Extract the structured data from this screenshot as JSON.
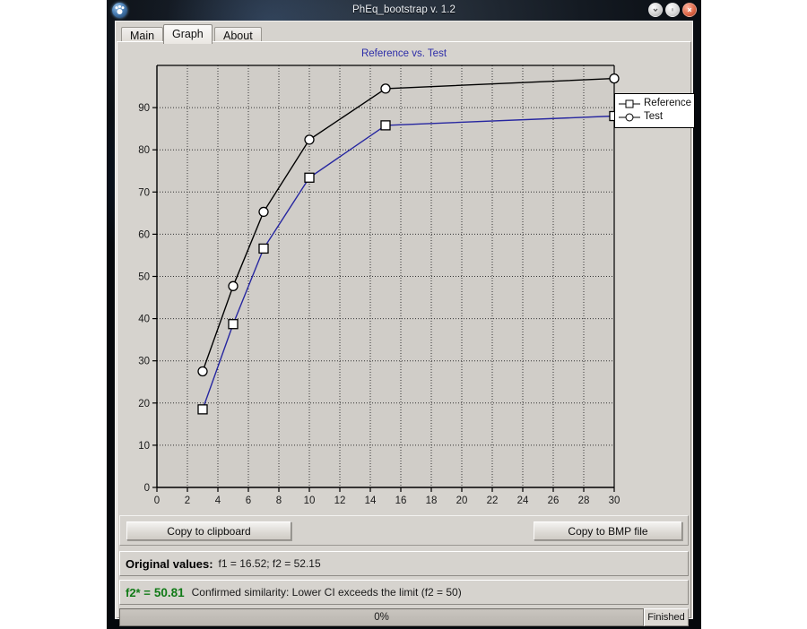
{
  "window": {
    "title": "PhEq_bootstrap v. 1.2",
    "app_icon": "paw-icon",
    "buttons": {
      "minimize": "minimize-icon",
      "maximize": "maximize-icon",
      "close": "close-icon"
    }
  },
  "tabs": [
    {
      "label": "Main",
      "selected": false
    },
    {
      "label": "Graph",
      "selected": true
    },
    {
      "label": "About",
      "selected": false
    }
  ],
  "toolbar": {
    "copy_clipboard_label": "Copy to clipboard",
    "copy_bmp_label": "Copy to BMP file"
  },
  "results": {
    "original_label": "Original values:",
    "original_values": "f1 =  16.52;   f2 =  52.15",
    "f2_label": "f2* =",
    "f2_value": "50.81",
    "f2_message": "Confirmed similarity: Lower CI exceeds the limit (f2 = 50)"
  },
  "status": {
    "progress_text": "0%",
    "progress_percent": 0,
    "state_label": "Finished"
  },
  "colors": {
    "title_text": "#2c2ca8",
    "reference_line": "#2626a0",
    "test_line": "#000000",
    "plot_background": "#d0cdc8",
    "result_green": "#117a17"
  },
  "chart_data": {
    "type": "line",
    "title": "Reference vs. Test",
    "xlabel": "",
    "ylabel": "",
    "xlim": [
      0,
      30
    ],
    "ylim": [
      0,
      100
    ],
    "xticks": [
      0,
      2,
      4,
      6,
      8,
      10,
      12,
      14,
      16,
      18,
      20,
      22,
      24,
      26,
      28,
      30
    ],
    "yticks": [
      0,
      10,
      20,
      30,
      40,
      50,
      60,
      70,
      80,
      90
    ],
    "grid": true,
    "legend_position": "top-right",
    "x": [
      3,
      5,
      7,
      10,
      15,
      30
    ],
    "series": [
      {
        "name": "Reference",
        "marker": "square",
        "color": "#2626a0",
        "values": [
          18.5,
          38.7,
          56.6,
          73.4,
          85.8,
          88.0
        ]
      },
      {
        "name": "Test",
        "marker": "circle",
        "color": "#000000",
        "values": [
          27.5,
          47.7,
          65.3,
          82.4,
          94.5,
          96.9
        ]
      }
    ]
  }
}
